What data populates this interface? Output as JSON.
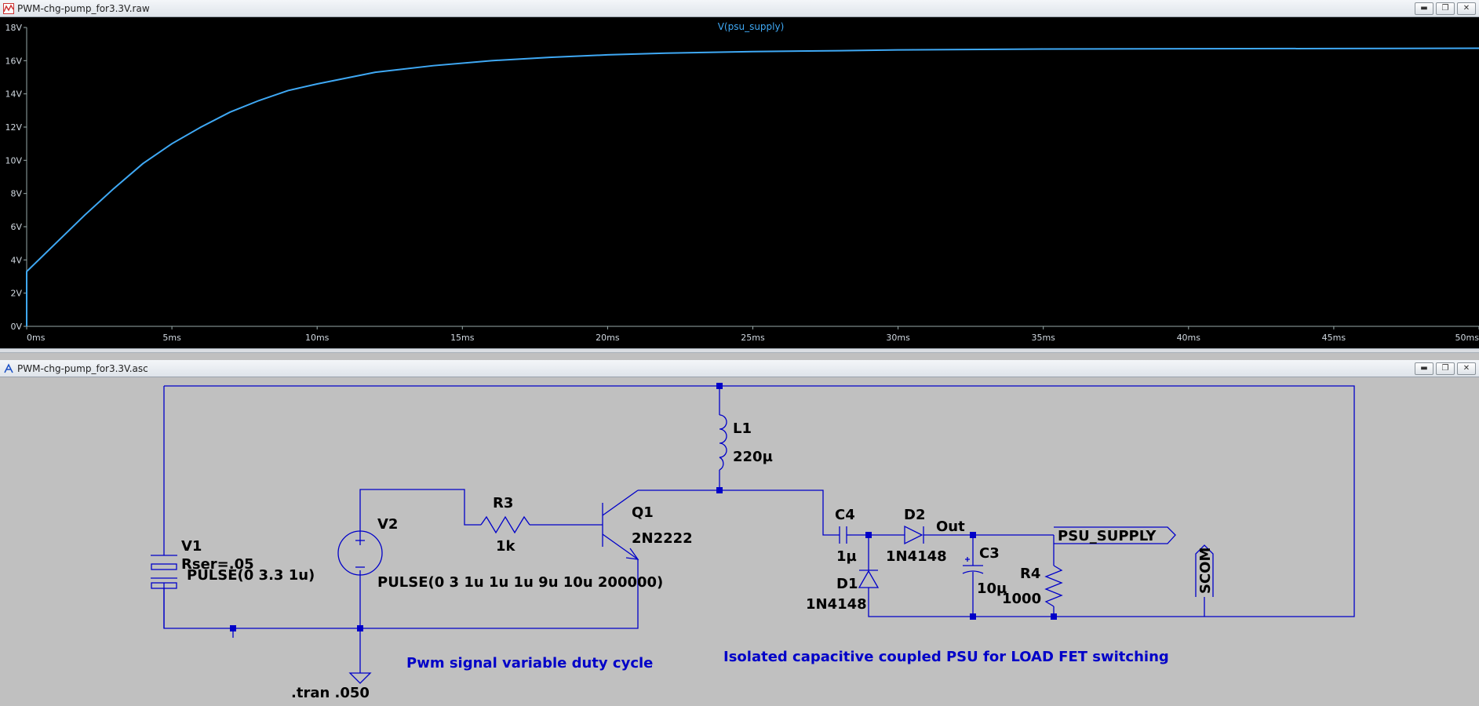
{
  "waveform_window": {
    "title": "PWM-chg-pump_for3.3V.raw",
    "trace_label": "V(psu_supply)",
    "trace_color": "#3fa9f5",
    "y_ticks": [
      "18V",
      "16V",
      "14V",
      "12V",
      "10V",
      "8V",
      "6V",
      "4V",
      "2V",
      "0V"
    ],
    "x_ticks": [
      "0ms",
      "5ms",
      "10ms",
      "15ms",
      "20ms",
      "25ms",
      "30ms",
      "35ms",
      "40ms",
      "45ms",
      "50ms"
    ]
  },
  "schematic_window": {
    "title": "PWM-chg-pump_for3.3V.asc",
    "wire_color": "#0000c8",
    "components": {
      "v1": {
        "name": "V1",
        "rser": "Rser=.05",
        "value": "PULSE(0 3.3 1u)"
      },
      "v2": {
        "name": "V2",
        "value": "PULSE(0 3 1u 1u 1u 9u 10u 200000)"
      },
      "r3": {
        "name": "R3",
        "value": "1k"
      },
      "q1": {
        "name": "Q1",
        "value": "2N2222"
      },
      "l1": {
        "name": "L1",
        "value": "220µ"
      },
      "c4": {
        "name": "C4",
        "value": "1µ"
      },
      "d2": {
        "name": "D2",
        "value": "1N4148"
      },
      "d1": {
        "name": "D1",
        "value": "1N4148"
      },
      "c3": {
        "name": "C3",
        "value": "10µ"
      },
      "r4": {
        "name": "R4",
        "value": "1000"
      }
    },
    "net_out": "Out",
    "port_psu": "PSU_SUPPLY",
    "port_scom": "SCOM",
    "tran_directive": ".tran .050",
    "comment_pwm": "Pwm signal variable duty cycle",
    "comment_psu": "Isolated capacitive coupled PSU for LOAD FET switching"
  },
  "window_buttons": {
    "minimize": "▬",
    "restore": "❐",
    "close": "✕"
  },
  "chart_data": {
    "type": "line",
    "title": "V(psu_supply)",
    "xlabel": "",
    "ylabel": "",
    "x_unit": "ms",
    "y_unit": "V",
    "xlim": [
      0,
      50
    ],
    "ylim": [
      0,
      18
    ],
    "grid": false,
    "series": [
      {
        "name": "V(psu_supply)",
        "x": [
          0,
          1,
          2,
          3,
          4,
          5,
          6,
          7,
          8,
          9,
          10,
          12,
          14,
          16,
          18,
          20,
          22,
          25,
          28,
          30,
          35,
          40,
          45,
          50
        ],
        "y": [
          3.3,
          5.0,
          6.7,
          8.3,
          9.8,
          11.0,
          12.0,
          12.9,
          13.6,
          14.2,
          14.6,
          15.3,
          15.7,
          16.0,
          16.2,
          16.35,
          16.45,
          16.55,
          16.6,
          16.65,
          16.7,
          16.72,
          16.73,
          16.75
        ]
      }
    ]
  }
}
